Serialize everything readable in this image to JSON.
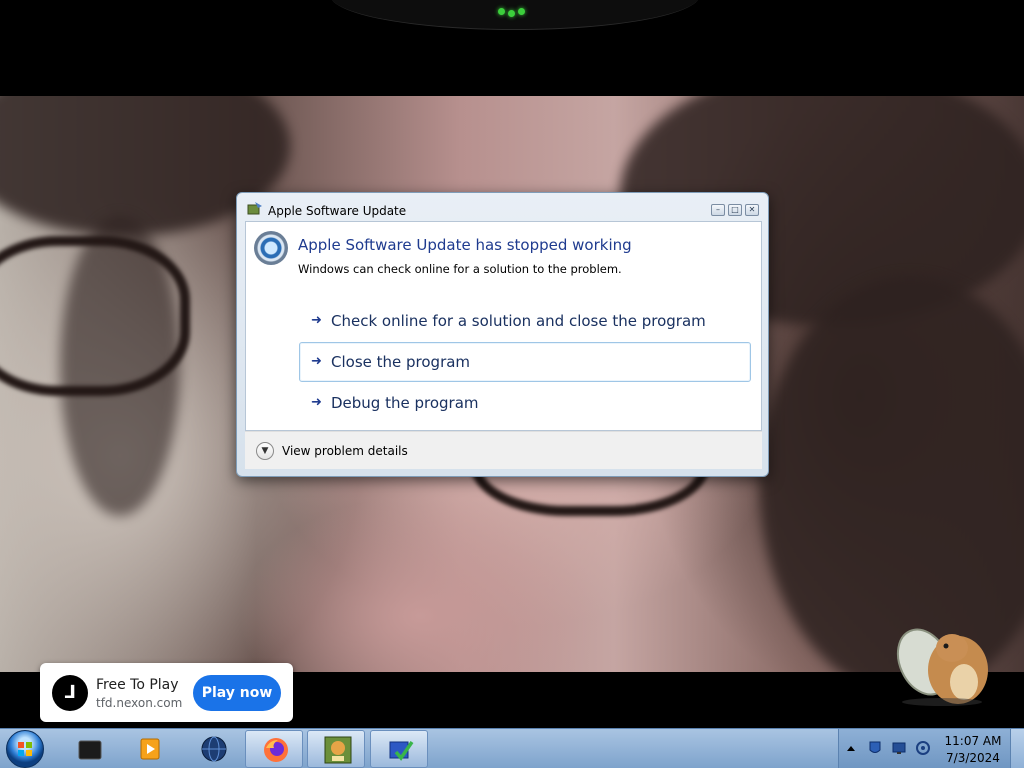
{
  "dialog": {
    "title": "Apple Software Update",
    "main_instruction": "Apple Software Update has stopped working",
    "content": "Windows can check online for a solution to the problem.",
    "commands": [
      {
        "label": "Check online for a solution and close the program",
        "selected": false
      },
      {
        "label": "Close the program",
        "selected": true
      },
      {
        "label": "Debug the program",
        "selected": false
      }
    ],
    "details_label": "View problem details",
    "window_buttons": [
      "minimize",
      "maximize",
      "close"
    ]
  },
  "ad": {
    "title": "Free To Play",
    "domain": "tfd.nexon.com",
    "button_label": "Play now"
  },
  "taskbar": {
    "pinned": [
      "media-center-icon",
      "vlc-player-icon",
      "globe-icon",
      "firefox-icon",
      "box-game-icon",
      "checkmark-shortcut-icon"
    ],
    "clock_time": "11:07 AM",
    "clock_date": "7/3/2024"
  },
  "colors": {
    "instruction_blue": "#1f3b8f",
    "ad_button": "#1a73e8",
    "taskbar_top": "#a9c4e2",
    "indicator_green": "#3ccf3c"
  }
}
